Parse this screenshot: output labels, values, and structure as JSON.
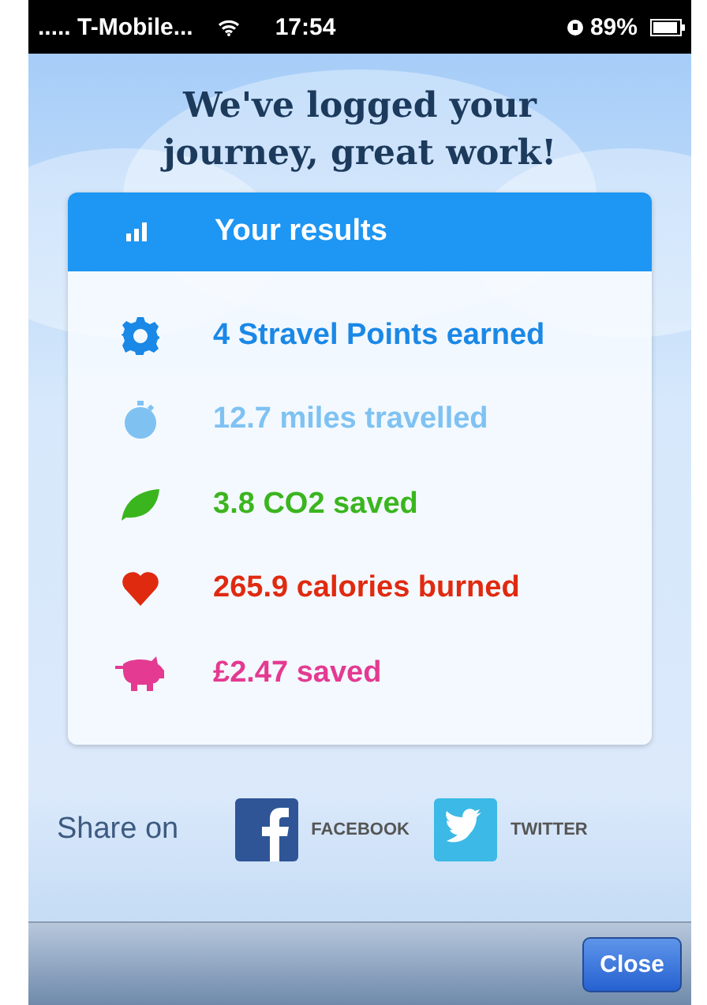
{
  "status_bar": {
    "carrier": "..... T-Mobile...",
    "time": "17:54",
    "battery": "89%"
  },
  "title": "We've logged your journey, great work!",
  "results": {
    "heading": "Your results",
    "items": [
      {
        "kind": "gear",
        "text": "4 Stravel Points earned",
        "color": "#1a88e6"
      },
      {
        "kind": "stopwatch",
        "text": "12.7 miles travelled",
        "color": "#7fc2f2"
      },
      {
        "kind": "leaf",
        "text": "3.8 CO2 saved",
        "color": "#3bb51e"
      },
      {
        "kind": "heart",
        "text": "265.9 calories burned",
        "color": "#e02a10"
      },
      {
        "kind": "piggy",
        "text": "£2.47 saved",
        "color": "#e43a92"
      }
    ]
  },
  "share": {
    "label": "Share on",
    "services": [
      {
        "kind": "facebook",
        "label": "FACEBOOK"
      },
      {
        "kind": "twitter",
        "label": "TWITTER"
      }
    ]
  },
  "toolbar": {
    "button": "Close"
  }
}
